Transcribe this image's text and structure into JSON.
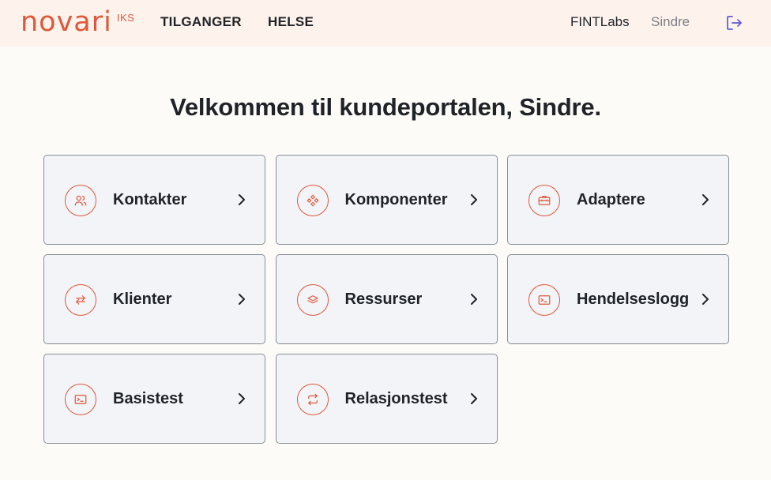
{
  "header": {
    "logo_text": "novari",
    "logo_suffix": "IKS",
    "nav": [
      {
        "label": "TILGANGER"
      },
      {
        "label": "HELSE"
      }
    ],
    "org_label": "FINTLabs",
    "user_label": "Sindre",
    "logout_icon": "logout-icon"
  },
  "main": {
    "welcome": "Velkommen til kundeportalen, Sindre.",
    "cards": [
      {
        "label": "Kontakter",
        "icon": "contacts-icon"
      },
      {
        "label": "Komponenter",
        "icon": "components-icon"
      },
      {
        "label": "Adaptere",
        "icon": "toolbox-icon"
      },
      {
        "label": "Klienter",
        "icon": "swap-arrows-icon"
      },
      {
        "label": "Ressurser",
        "icon": "layers-icon"
      },
      {
        "label": "Hendelseslogg",
        "icon": "terminal-icon"
      },
      {
        "label": "Basistest",
        "icon": "terminal-icon"
      },
      {
        "label": "Relasjonstest",
        "icon": "repeat-arrows-icon"
      }
    ]
  },
  "colors": {
    "accent": "#e0573a",
    "header_bg": "#fdf3ec",
    "card_bg": "#f2f4f7",
    "card_border": "#868d96",
    "logout": "#5b5bd6"
  }
}
